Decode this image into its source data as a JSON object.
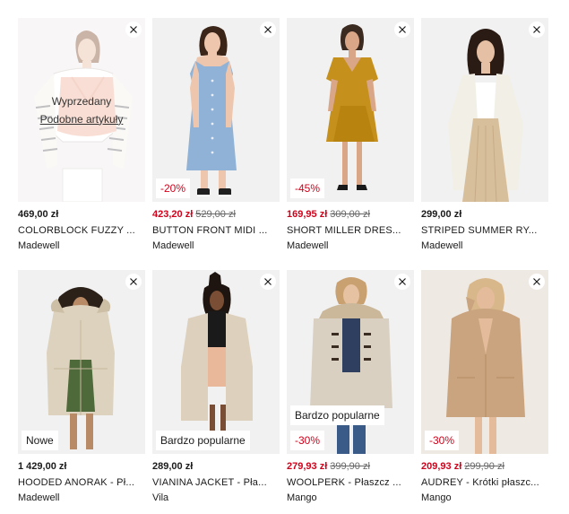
{
  "close_icon": "close-icon",
  "colors": {
    "sale_red": "#d0021b",
    "text": "#1a1a1a",
    "old_price": "#666666"
  },
  "products": [
    {
      "price": "469,00 zł",
      "old_price": "",
      "title": "COLORBLOCK FUZZY ...",
      "brand": "Madewell",
      "sold_out": true,
      "sold_out_text": "Wyprzedany",
      "similar_link": "Podobne artykuły",
      "badges": []
    },
    {
      "price": "423,20 zł",
      "old_price": "529,00 zł",
      "title": "BUTTON FRONT MIDI ...",
      "brand": "Madewell",
      "sold_out": false,
      "badges": [
        {
          "text": "-20%",
          "kind": "disc"
        }
      ]
    },
    {
      "price": "169,95 zł",
      "old_price": "309,00 zł",
      "title": "SHORT MILLER DRES...",
      "brand": "Madewell",
      "sold_out": false,
      "badges": [
        {
          "text": "-45%",
          "kind": "disc"
        }
      ]
    },
    {
      "price": "299,00 zł",
      "old_price": "",
      "title": "STRIPED SUMMER RY...",
      "brand": "Madewell",
      "sold_out": false,
      "badges": []
    },
    {
      "price": "1 429,00 zł",
      "old_price": "",
      "title": "HOODED ANORAK - Pł...",
      "brand": "Madewell",
      "sold_out": false,
      "badges": [
        {
          "text": "Nowe",
          "kind": "flag"
        }
      ]
    },
    {
      "price": "289,00 zł",
      "old_price": "",
      "title": "VIANINA JACKET - Pła...",
      "brand": "Vila",
      "sold_out": false,
      "badges": [
        {
          "text": "Bardzo popularne",
          "kind": "flag"
        }
      ]
    },
    {
      "price": "279,93 zł",
      "old_price": "399,90 zł",
      "title": "WOOLPERK - Płaszcz ...",
      "brand": "Mango",
      "sold_out": false,
      "badges": [
        {
          "text": "Bardzo popularne",
          "kind": "flag"
        },
        {
          "text": "-30%",
          "kind": "disc"
        }
      ]
    },
    {
      "price": "209,93 zł",
      "old_price": "299,90 zł",
      "title": "AUDREY - Krótki płaszc...",
      "brand": "Mango",
      "sold_out": false,
      "badges": [
        {
          "text": "-30%",
          "kind": "disc"
        }
      ]
    }
  ]
}
